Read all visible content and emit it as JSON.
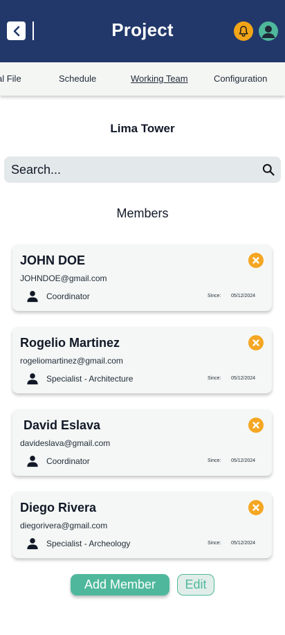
{
  "header": {
    "title": "Project",
    "colors": {
      "background": "#22386b",
      "bell": "#f2a417",
      "avatar": "#4fb89c"
    }
  },
  "tabs": [
    {
      "label": "al File",
      "active": false
    },
    {
      "label": "Schedule",
      "active": false
    },
    {
      "label": "Working Team",
      "active": true
    },
    {
      "label": "Configuration",
      "active": false
    }
  ],
  "project_name": "Lima Tower",
  "search": {
    "placeholder": "Search...",
    "value": ""
  },
  "members_title": "Members",
  "members": [
    {
      "name": "JOHN DOE",
      "email": "JOHNDOE@gmail.com",
      "role": "Coordinator",
      "since_label": "Since:",
      "since": "05/12/2024"
    },
    {
      "name": "Rogelio Martinez",
      "email": "rogeliomartinez@gmail.com",
      "role": "Specialist - Architecture",
      "since_label": "Since:",
      "since": "05/12/2024"
    },
    {
      "name": " David Eslava",
      "email": "davideslava@gmail.com",
      "role": "Coordinator",
      "since_label": "Since:",
      "since": "05/12/2024"
    },
    {
      "name": "Diego Rivera",
      "email": "diegorivera@gmail.com",
      "role": "Specialist - Archeology",
      "since_label": "Since:",
      "since": "05/12/2024"
    }
  ],
  "actions": {
    "add_label": "Add Member",
    "edit_label": "Edit"
  },
  "colors": {
    "accent": "#4fb89c",
    "remove": "#f5a623",
    "card": "#f4f7f5"
  },
  "icons": [
    "chevron-left-icon",
    "bell-icon",
    "user-avatar-icon",
    "search-icon",
    "person-icon",
    "close-circle-icon"
  ]
}
